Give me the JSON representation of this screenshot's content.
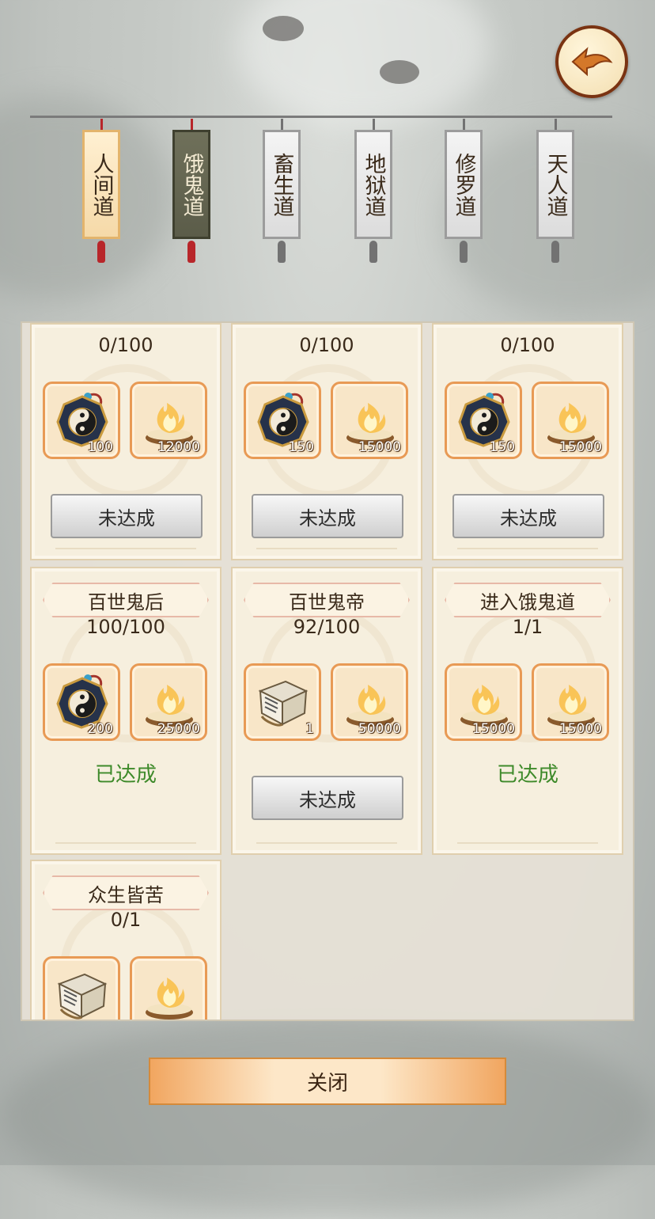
{
  "tabs": [
    {
      "label": "人间道",
      "state": "active"
    },
    {
      "label": "饿鬼道",
      "state": "visited"
    },
    {
      "label": "畜生道",
      "state": "locked"
    },
    {
      "label": "地狱道",
      "state": "locked"
    },
    {
      "label": "修罗道",
      "state": "locked"
    },
    {
      "label": "天人道",
      "state": "locked"
    }
  ],
  "cards": [
    {
      "title": "",
      "progress": "0/100",
      "rewards": [
        {
          "icon": "bagua-compass-icon",
          "qty": "100"
        },
        {
          "icon": "spirit-flame-icon",
          "qty": "12000"
        }
      ],
      "status": "未达成",
      "done": false
    },
    {
      "title": "",
      "progress": "0/100",
      "rewards": [
        {
          "icon": "bagua-compass-icon",
          "qty": "150"
        },
        {
          "icon": "spirit-flame-icon",
          "qty": "15000"
        }
      ],
      "status": "未达成",
      "done": false
    },
    {
      "title": "",
      "progress": "0/100",
      "rewards": [
        {
          "icon": "bagua-compass-icon",
          "qty": "150"
        },
        {
          "icon": "spirit-flame-icon",
          "qty": "15000"
        }
      ],
      "status": "未达成",
      "done": false
    },
    {
      "title": "百世鬼后",
      "progress": "100/100",
      "rewards": [
        {
          "icon": "bagua-compass-icon",
          "qty": "200"
        },
        {
          "icon": "spirit-flame-icon",
          "qty": "25000"
        }
      ],
      "status": "已达成",
      "done": true
    },
    {
      "title": "百世鬼帝",
      "progress": "92/100",
      "rewards": [
        {
          "icon": "scroll-book-icon",
          "qty": "1"
        },
        {
          "icon": "spirit-flame-icon",
          "qty": "50000"
        }
      ],
      "status": "未达成",
      "done": false
    },
    {
      "title": "进入饿鬼道",
      "progress": "1/1",
      "rewards": [
        {
          "icon": "spirit-flame-icon",
          "qty": "15000"
        },
        {
          "icon": "spirit-flame-icon",
          "qty": "15000"
        }
      ],
      "status": "已达成",
      "done": true
    },
    {
      "title": "众生皆苦",
      "progress": "0/1",
      "rewards": [
        {
          "icon": "scroll-book-icon",
          "qty": ""
        },
        {
          "icon": "spirit-flame-icon",
          "qty": ""
        }
      ],
      "status": "",
      "done": false
    }
  ],
  "close_label": "关闭",
  "colors": {
    "done_text": "#3e8a2a",
    "accent": "#e89a55",
    "back_border": "#7a3312"
  }
}
